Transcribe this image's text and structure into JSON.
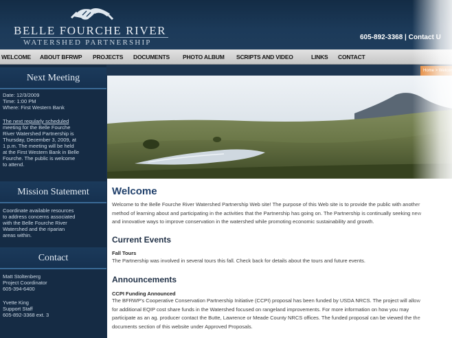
{
  "header": {
    "logo_title": "BELLE FOURCHE RIVER",
    "logo_subtitle": "WATERSHED PARTNERSHIP",
    "phone_contact": "605-892-3368 | Contact U"
  },
  "nav": {
    "items": [
      {
        "label": "WELCOME"
      },
      {
        "label": "ABOUT BFRWP"
      },
      {
        "label": "PROJECTS"
      },
      {
        "label": "DOCUMENTS"
      },
      {
        "label": "PHOTO ALBUM"
      },
      {
        "label": "SCRIPTS AND VIDEO"
      },
      {
        "label": "LINKS"
      },
      {
        "label": "CONTACT"
      }
    ]
  },
  "breadcrumb": "Home > Welcome",
  "sidebar": {
    "next_meeting": {
      "title": "Next Meeting",
      "details": [
        "Date: 12/3/2009",
        "Time: 1:00 PM",
        "Where: First Western Bank"
      ],
      "text_lines": [
        "The next regularly scheduled",
        "meeting for the Belle Fourche",
        "River Watershed Partnership is",
        "Thursday, December 3, 2009, at",
        "1 p.m. The meeting will be held",
        "at the First Western Bank in Belle",
        "Fourche. The public is welcome",
        "to attend."
      ]
    },
    "mission": {
      "title": "Mission Statement",
      "text_lines": [
        "Coordinate available resources",
        "to address concerns associated",
        "with the Belle Fourche River",
        "Watershed and the riparian",
        "areas within."
      ]
    },
    "contact": {
      "title": "Contact",
      "people": [
        {
          "name": "Matt Stoltenberg",
          "role": "Project Coordinator",
          "phone": "605-394-6400"
        },
        {
          "name": "Yvette King",
          "role": "Support Staff",
          "phone": "605-892-3368 ext. 3"
        }
      ]
    }
  },
  "main": {
    "welcome_title": "Welcome",
    "welcome_lines": [
      "Welcome to the Belle Fourche River Watershed Partnership Web site! The purpose of this Web site is to provide the public with another",
      "method of learning about and participating in the activities that the Partnership has going on. The Partnership is continually seeking new",
      "and innovative ways to improve conservation in the watershed while promoting economic sustainability and growth."
    ],
    "current_events_title": "Current Events",
    "fall_tours_label": "Fall Tours",
    "fall_tours_line": "The Partnership was involved in several tours this fall. Check back for details about the tours and future events.",
    "announcements_title": "Announcements",
    "funding_label": "CCPI Funding Announced",
    "funding_lines": [
      "The BFRWP's Cooperative Conservation Partnership Initiative (CCPI) proposal has been funded by USDA NRCS. The project will allow",
      "for additional EQIP cost share funds in the Watershed focused on rangeland improvements.  For more information on how you may",
      "participate as an ag. producer contact the Butte, Lawrence or Meade County NRCS offices.  The funded proposal can be viewed the the",
      "documents section of this website under Approved Proposals."
    ]
  },
  "colors": {
    "header_bg": "#1c3a59",
    "sidebar_bg": "#152b44",
    "accent_orange": "#e07418",
    "heading_blue": "#1f3f6a"
  }
}
